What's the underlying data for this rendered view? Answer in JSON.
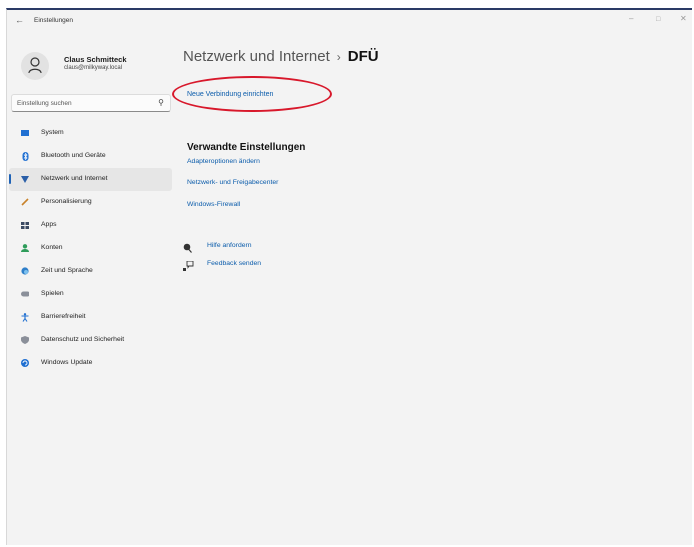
{
  "window": {
    "app_title": "Einstellungen",
    "controls": {
      "minimize": "–",
      "maximize": "□",
      "close": "✕"
    }
  },
  "profile": {
    "name": "Claus Schmitteck",
    "email": "claus@milkyway.local"
  },
  "search": {
    "placeholder": "Einstellung suchen"
  },
  "sidebar": {
    "items": [
      {
        "label": "System",
        "icon": "system-icon",
        "active": false
      },
      {
        "label": "Bluetooth und Geräte",
        "icon": "bluetooth-icon",
        "active": false
      },
      {
        "label": "Netzwerk und Internet",
        "icon": "network-icon",
        "active": true
      },
      {
        "label": "Personalisierung",
        "icon": "pen-icon",
        "active": false
      },
      {
        "label": "Apps",
        "icon": "apps-icon",
        "active": false
      },
      {
        "label": "Konten",
        "icon": "person-icon",
        "active": false
      },
      {
        "label": "Zeit und Sprache",
        "icon": "clock-globe-icon",
        "active": false
      },
      {
        "label": "Spielen",
        "icon": "gamepad-icon",
        "active": false
      },
      {
        "label": "Barrierefreiheit",
        "icon": "accessibility-icon",
        "active": false
      },
      {
        "label": "Datenschutz und Sicherheit",
        "icon": "shield-icon",
        "active": false
      },
      {
        "label": "Windows Update",
        "icon": "update-icon",
        "active": false
      }
    ]
  },
  "main": {
    "breadcrumb_root": "Netzwerk und Internet",
    "breadcrumb_separator": "›",
    "breadcrumb_current": "DFÜ",
    "new_connection": "Neue Verbindung einrichten",
    "related_heading": "Verwandte Einstellungen",
    "related_links": [
      "Adapteroptionen ändern",
      "Netzwerk- und Freigabecenter",
      "Windows-Firewall"
    ],
    "help": "Hilfe anfordern",
    "feedback": "Feedback senden"
  },
  "colors": {
    "accent": "#0b5cab",
    "annotation": "#d8182b",
    "active_bg": "#e6e6e6"
  }
}
